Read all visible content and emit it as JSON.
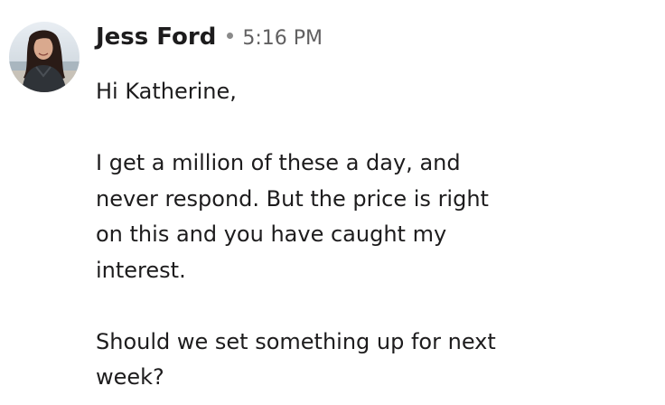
{
  "message": {
    "author": "Jess Ford",
    "timestamp": "5:16 PM",
    "greeting": "Hi Katherine,",
    "paragraph_1_line_1": "I get a million of these a day, and",
    "paragraph_1_line_2": "never respond. But the price is right",
    "paragraph_1_line_3": "on this and you have caught my",
    "paragraph_1_line_4": "interest.",
    "paragraph_2_line_1": "Should we set something up for next",
    "paragraph_2_line_2": "week?"
  },
  "colors": {
    "author_text": "#1d1c1d",
    "timestamp_text": "#616061",
    "body_text": "#1d1c1d",
    "background": "#ffffff"
  },
  "icons": {
    "avatar": "user-avatar-photo"
  }
}
